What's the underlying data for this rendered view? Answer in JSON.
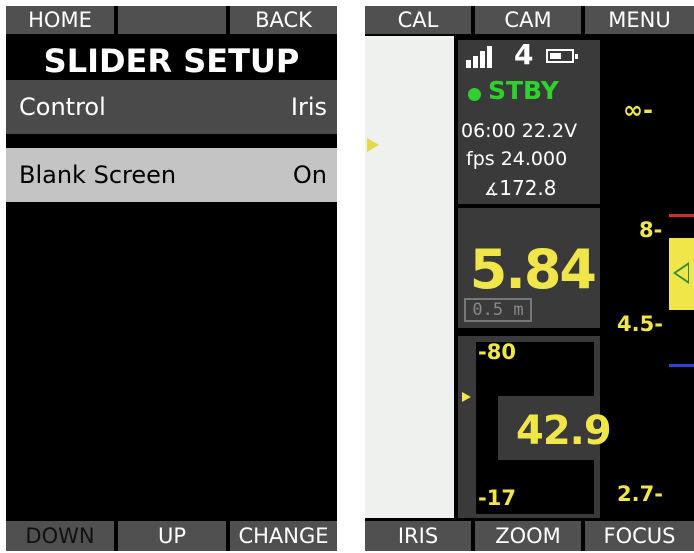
{
  "left_panel": {
    "top_softkeys": {
      "home": "HOME",
      "blank": "",
      "back": "BACK"
    },
    "title": "SLIDER SETUP",
    "menu": [
      {
        "label": "Control",
        "value": "Iris"
      },
      {
        "label": "Blank Screen",
        "value": "On"
      }
    ],
    "bottom_softkeys": {
      "down": "DOWN",
      "up": "UP",
      "change": "CHANGE"
    }
  },
  "right_panel": {
    "top_softkeys": {
      "cal": "CAL",
      "cam": "CAM",
      "menu": "MENU"
    },
    "status": {
      "camera_number": "4",
      "state": "STBY",
      "time_voltage": "06:00  22.2V",
      "fps": "fps 24.000",
      "shutter": "172.8"
    },
    "iris": {
      "value": "5.84",
      "distance": "0.5 m"
    },
    "zoom": {
      "top": "-80",
      "value": "42.9",
      "bottom": "-17"
    },
    "focus_scale": {
      "inf": "∞-",
      "mark1": "8-",
      "mark2": "4.5-",
      "mark3": "2.7-"
    },
    "bottom_softkeys": {
      "iris": "IRIS",
      "zoom": "ZOOM",
      "focus": "FOCUS"
    }
  },
  "colors": {
    "accent_yellow": "#f0e64a",
    "status_green": "#2ed12e",
    "selected_row": "#c4c4c4",
    "softkey_gray": "#505050",
    "panel_gray": "#3a3a3a"
  }
}
